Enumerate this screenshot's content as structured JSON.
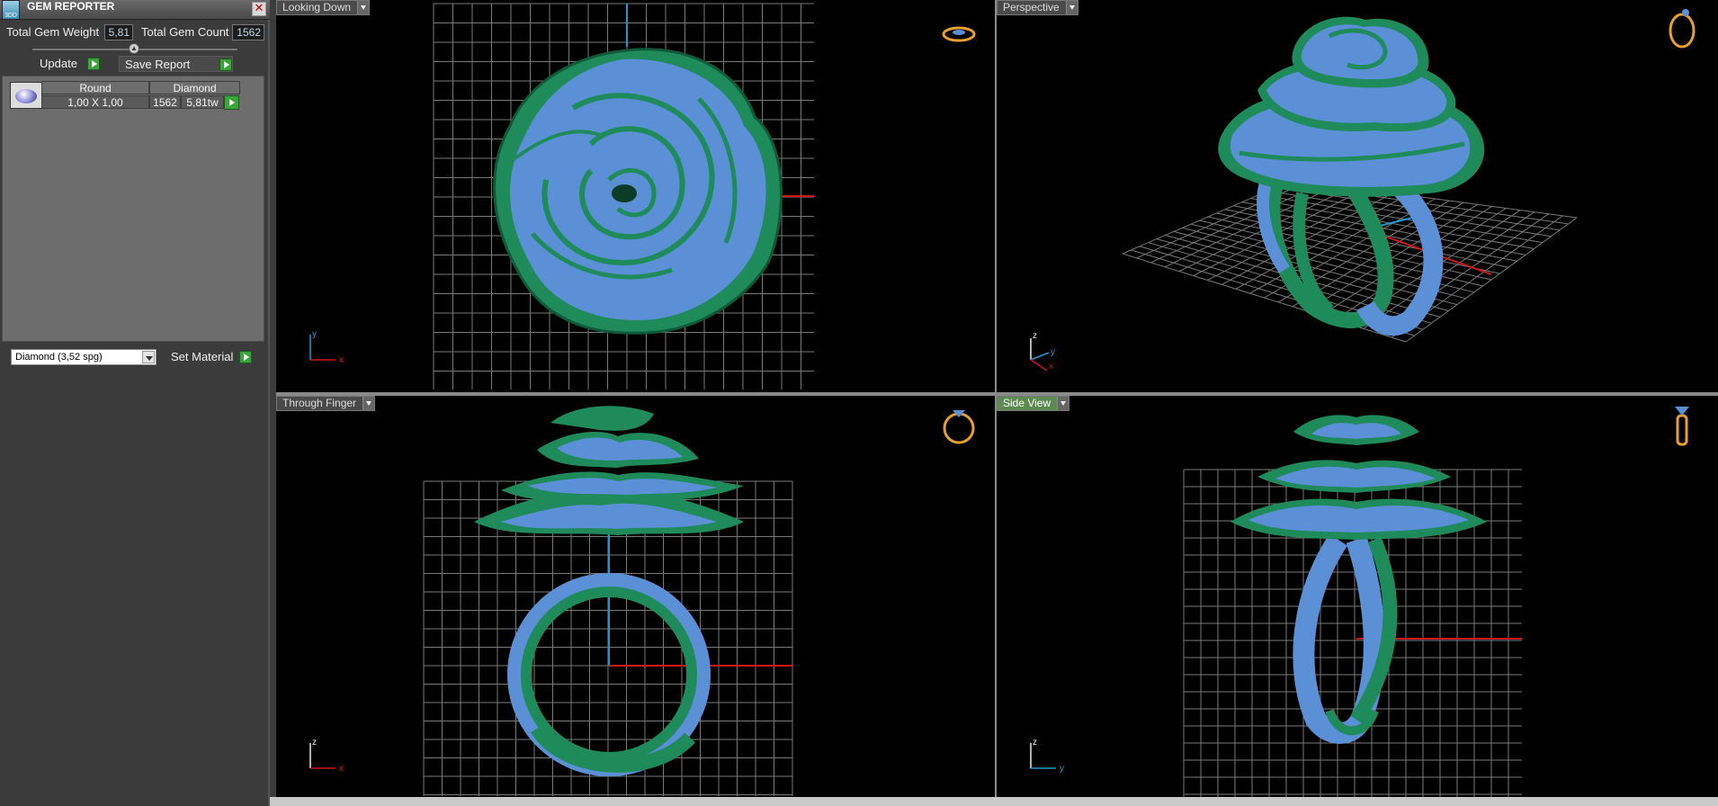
{
  "panel": {
    "title": "GEM REPORTER",
    "app_icon_text": "3DD",
    "close_glyph": "✕",
    "total_weight_label": "Total Gem Weight",
    "total_weight_value": "5,81",
    "total_count_label": "Total Gem Count",
    "total_count_value": "1562",
    "update_label": "Update",
    "save_report_label": "Save Report",
    "gem_table": {
      "col_shape": "Round",
      "col_type": "Diamond",
      "size": "1,00 X 1,00",
      "count": "1562",
      "weight": "5,81tw"
    },
    "material_value": "Diamond    (3,52 spg)",
    "set_material_label": "Set Material"
  },
  "viewports": {
    "top_left": {
      "label": "Looking Down",
      "axis_a": "y",
      "axis_b": "x"
    },
    "top_right": {
      "label": "Perspective",
      "axis_a": "z",
      "axis_b": "y",
      "axis_c": "x"
    },
    "bottom_left": {
      "label": "Through Finger",
      "axis_a": "z",
      "axis_b": "x"
    },
    "bottom_right": {
      "label": "Side View",
      "axis_a": "z",
      "axis_b": "y"
    }
  },
  "colors": {
    "metal": "#1f8a5a",
    "gems": "#5b8fd6",
    "grid": "#7a7a7a",
    "axis_red": "#d01818",
    "axis_blue": "#1a9ad0",
    "view_icon": "#e8a030"
  },
  "icons": {
    "top_left_view": "ring-top-view-icon",
    "top_right_view": "ring-perspective-icon",
    "bottom_left_view": "ring-front-view-icon",
    "bottom_right_view": "ring-side-view-icon"
  }
}
